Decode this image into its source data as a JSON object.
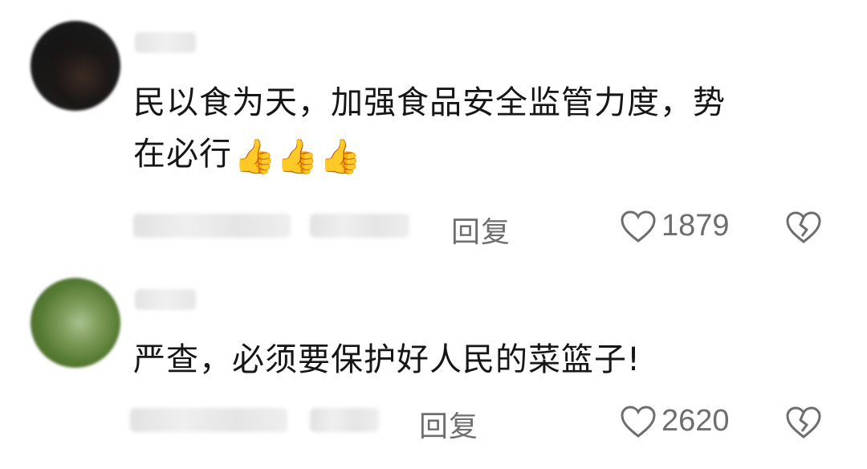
{
  "comments": [
    {
      "avatar": "blurred-avatar-dark",
      "text_line1": "民以食为天，加强食品安全监管力度，势",
      "text_line2": "在必行",
      "emoji": "👍👍👍",
      "reply_label": "回复",
      "like_count": "1879",
      "like_icon": "heart-outline-icon",
      "dislike_icon": "broken-heart-icon"
    },
    {
      "avatar": "blurred-avatar-green",
      "text": "严查，必须要保护好人民的菜篮子!",
      "reply_label": "回复",
      "like_count": "2620",
      "like_icon": "heart-outline-icon",
      "dislike_icon": "broken-heart-icon"
    }
  ],
  "colors": {
    "text": "#161616",
    "muted": "#6e6e6e",
    "background": "#ffffff"
  }
}
